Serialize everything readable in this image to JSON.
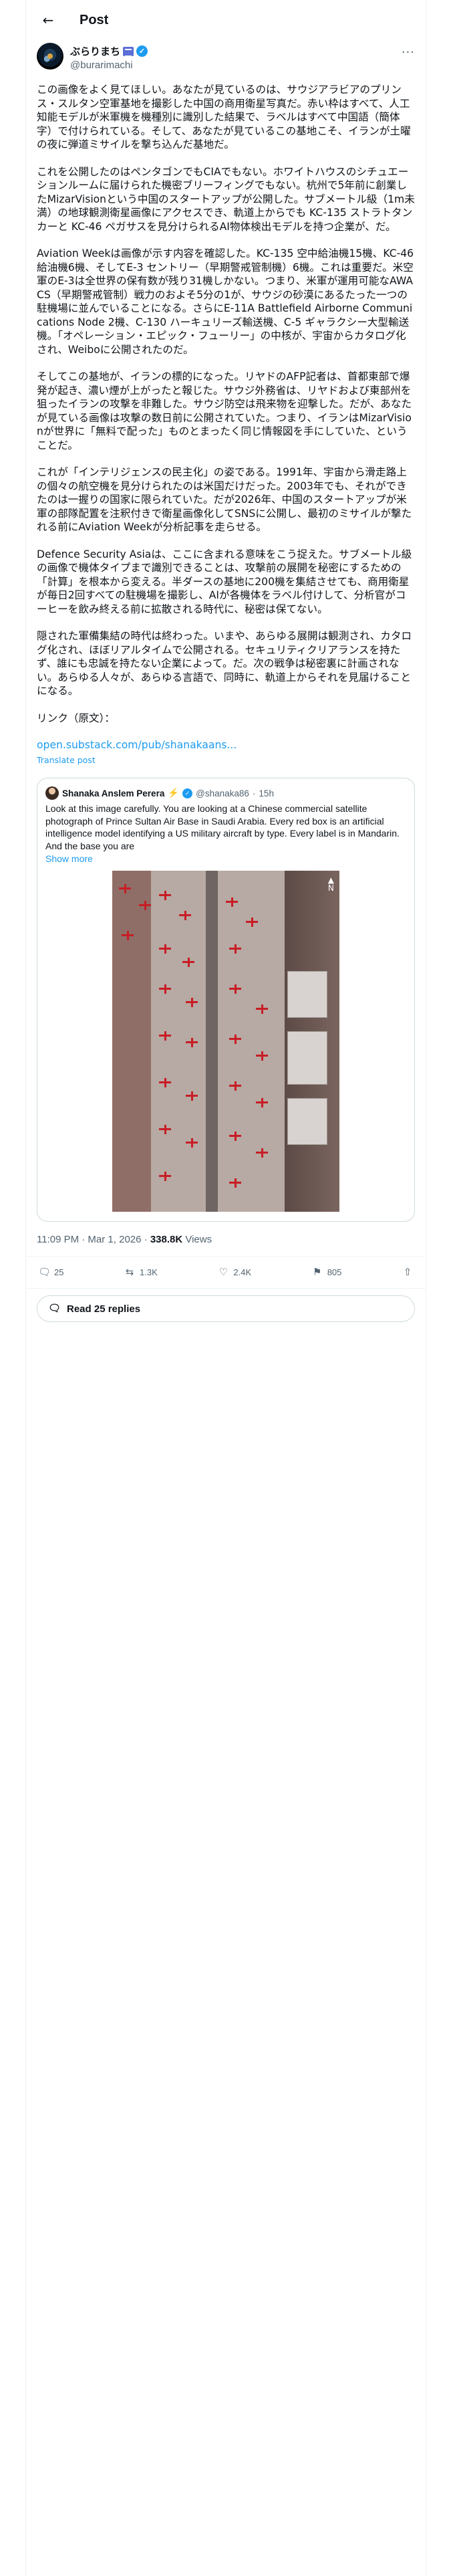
{
  "header": {
    "title": "Post"
  },
  "author": {
    "display_name": "ぶらりまち",
    "handle": "@burarimachi"
  },
  "post": {
    "paragraphs": [
      "この画像をよく見てほしい。あなたが見ているのは、サウジアラビアのプリンス・スルタン空軍基地を撮影した中国の商用衛星写真だ。赤い枠はすべて、人工知能モデルが米軍機を機種別に識別した結果で、ラベルはすべて中国語（簡体字）で付けられている。そして、あなたが見ているこの基地こそ、イランが土曜の夜に弾道ミサイルを撃ち込んだ基地だ。",
      "これを公開したのはペンタゴンでもCIAでもない。ホワイトハウスのシチュエーションルームに届けられた機密ブリーフィングでもない。杭州で5年前に創業したMizarVisionという中国のスタートアップが公開した。サブメートル級（1m未満）の地球観測衛星画像にアクセスでき、軌道上からでも KC-135 ストラトタンカーと KC-46 ペガサスを見分けられるAI物体検出モデルを持つ企業が、だ。",
      "Aviation Weekは画像が示す内容を確認した。KC-135 空中給油機15機、KC-46 給油機6機、そしてE-3 セントリー（早期警戒管制機）6機。これは重要だ。米空軍のE-3は全世界の保有数が残り31機しかない。つまり、米軍が運用可能なAWACS（早期警戒管制）戦力のおよそ5分の1が、サウジの砂漠にあるたった一つの駐機場に並んでいることになる。さらにE-11A Battlefield Airborne Communications Node 2機、C-130 ハーキュリーズ輸送機、C-5 ギャラクシー大型輸送機。「オペレーション・エピック・フューリー」の中核が、宇宙からカタログ化され、Weiboに公開されたのだ。",
      "そしてこの基地が、イランの標的になった。リヤドのAFP記者は、首都東部で爆発が起き、濃い煙が上がったと報じた。サウジ外務省は、リヤドおよび東部州を狙ったイランの攻撃を非難した。サウジ防空は飛来物を迎撃した。だが、あなたが見ている画像は攻撃の数日前に公開されていた。つまり、イランはMizarVisionが世界に「無料で配った」ものとまったく同じ情報図を手にしていた、ということだ。",
      "これが「インテリジェンスの民主化」の姿である。1991年、宇宙から滑走路上の個々の航空機を見分けられたのは米国だけだった。2003年でも、それができたのは一握りの国家に限られていた。だが2026年、中国のスタートアップが米軍の部隊配置を注釈付きで衛星画像化してSNSに公開し、最初のミサイルが撃たれる前にAviation Weekが分析記事を走らせる。",
      "Defence Security Asiaは、ここに含まれる意味をこう捉えた。サブメートル級の画像で機体タイプまで識別できることは、攻撃前の展開を秘密にするための「計算」を根本から変える。半ダースの基地に200機を集結させても、商用衛星が毎日2回すべての駐機場を撮影し、AIが各機体をラベル付けして、分析官がコーヒーを飲み終える前に拡散される時代に、秘密は保てない。",
      "隠された軍備集結の時代は終わった。いまや、あらゆる展開は観測され、カタログ化され、ほぼリアルタイムで公開される。セキュリティクリアランスを持たず、誰にも忠誠を持たない企業によって。だ。次の戦争は秘密裏に計画されない。あらゆる人々が、あらゆる言語で、同時に、軌道上からそれを見届けることになる。",
      "リンク（原文）："
    ],
    "link": "open.substack.com/pub/shanakaans...",
    "translate": "Translate post"
  },
  "quote": {
    "name": "Shanaka Anslem Perera",
    "emoji": "⚡",
    "handle": "@shanaka86",
    "age": "15h",
    "text": "Look at this image carefully. You are looking at a Chinese commercial satellite photograph of Prince Sultan Air Base in Saudi Arabia. Every red box is an artificial intelligence model identifying a US military aircraft by type. Every label is in Mandarin. And the base you are",
    "show_more": "Show more"
  },
  "meta": {
    "time": "11:09 PM · Mar 1, 2026 · ",
    "views": "338.8K",
    "views_label": " Views"
  },
  "actions": {
    "replies": "25",
    "reposts": "1.3K",
    "likes": "2.4K",
    "bookmarks": "805"
  },
  "read_replies": "Read 25 replies",
  "colors": {
    "accent": "#1d9bf0",
    "text": "#0f1419",
    "muted": "#536471",
    "box": "#c81d25"
  }
}
